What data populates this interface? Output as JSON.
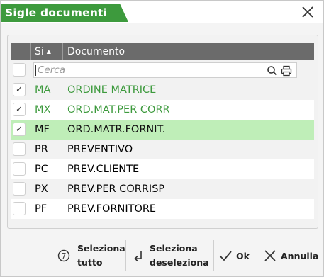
{
  "dialog": {
    "title": "Sigle documenti"
  },
  "grid": {
    "columns": {
      "si": "Si",
      "documento": "Documento"
    },
    "search_placeholder": "Cerca",
    "rows": [
      {
        "code": "MA",
        "desc": "ORDINE MATRICE",
        "checked": true
      },
      {
        "code": "MX",
        "desc": "ORD.MAT.PER CORR",
        "checked": true
      },
      {
        "code": "MF",
        "desc": "ORD.MATR.FORNIT.",
        "checked": true
      },
      {
        "code": "PR",
        "desc": "PREVENTIVO",
        "checked": false
      },
      {
        "code": "PC",
        "desc": "PREV.CLIENTE",
        "checked": false
      },
      {
        "code": "PX",
        "desc": "PREV.PER CORRISP",
        "checked": false
      },
      {
        "code": "PF",
        "desc": "PREV.FORNITORE",
        "checked": false
      }
    ]
  },
  "toolbar": {
    "select_all_line1": "Seleziona",
    "select_all_line2": "tutto",
    "select_all_icon": "7",
    "deselect_line1": "Seleziona",
    "deselect_line2": "deseleziona",
    "ok_label": "Ok",
    "cancel_label": "Annulla"
  },
  "colors": {
    "accent": "#3d9a3d",
    "selected_row": "#bfeeb8",
    "header": "#6b6b6b"
  }
}
